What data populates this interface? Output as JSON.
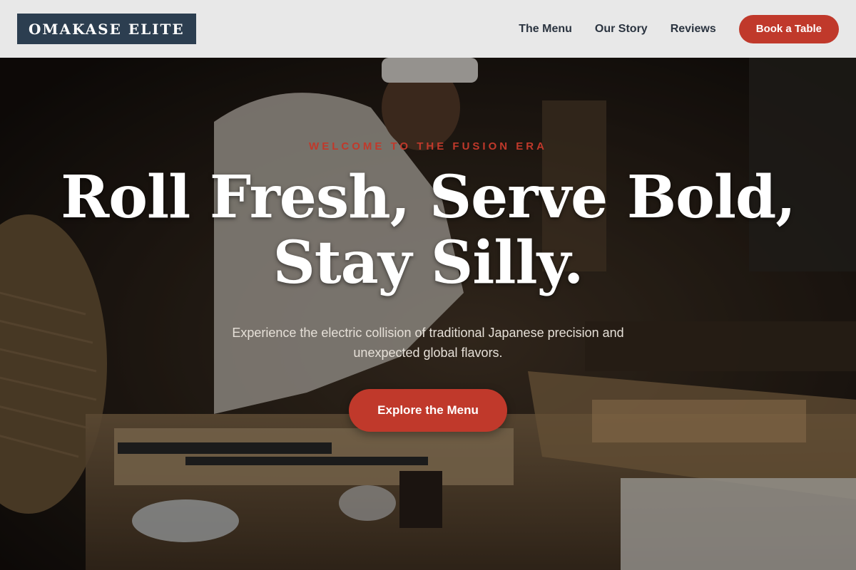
{
  "header": {
    "logo": "OMAKASE ELITE",
    "nav": [
      {
        "label": "The Menu"
      },
      {
        "label": "Our Story"
      },
      {
        "label": "Reviews"
      }
    ],
    "cta_label": "Book a Table"
  },
  "hero": {
    "eyebrow": "WELCOME TO THE FUSION ERA",
    "headline_line1": "Roll Fresh, Serve Bold,",
    "headline_line2": "Stay Silly.",
    "subtext": "Experience the electric collision of traditional Japanese precision and unexpected global flavors.",
    "cta_label": "Explore the Menu",
    "image_subject": "sushi-chef-at-counter-photo"
  },
  "colors": {
    "accent": "#c0392b",
    "logo_bg": "#2c3e50",
    "header_bg": "#e8e8e8",
    "nav_text": "#2b3440"
  }
}
